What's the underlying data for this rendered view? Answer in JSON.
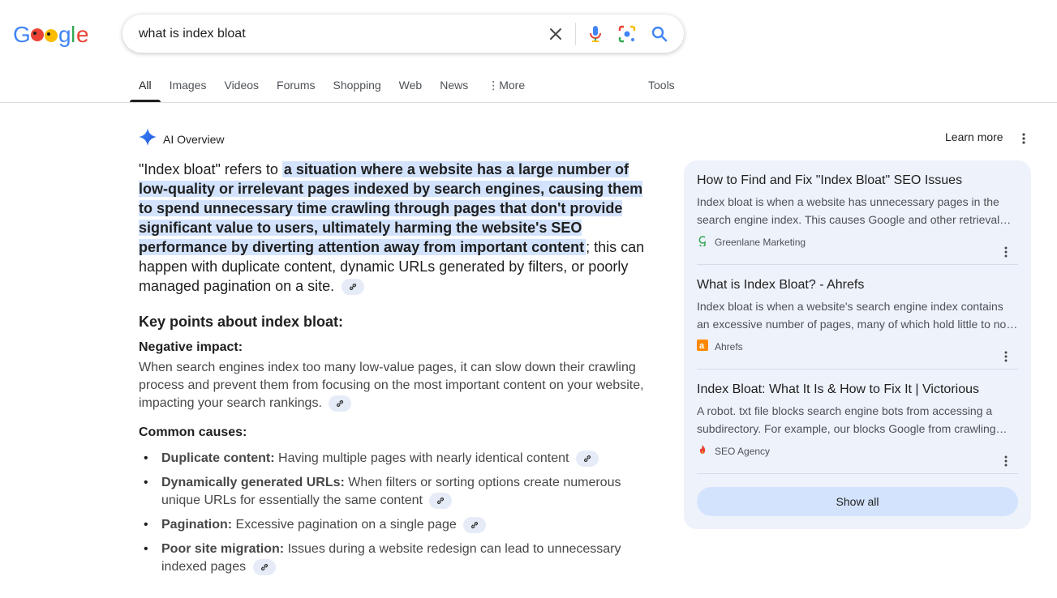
{
  "logo": {
    "text": "Google"
  },
  "search": {
    "query": "what is index bloat"
  },
  "tabs": [
    {
      "label": "All"
    },
    {
      "label": "Images"
    },
    {
      "label": "Videos"
    },
    {
      "label": "Forums"
    },
    {
      "label": "Shopping"
    },
    {
      "label": "Web"
    },
    {
      "label": "News"
    },
    {
      "label": "More"
    }
  ],
  "tools_label": "Tools",
  "ai_overview": {
    "label": "AI Overview",
    "learn_more": "Learn more",
    "intro_pre": "\"Index bloat\" refers to ",
    "intro_highlight": "a situation where a website has a large number of low-quality or irrelevant pages indexed by search engines, causing them to spend unnecessary time crawling through pages that don't provide significant value to users, ultimately harming the website's SEO performance by diverting attention away from important content",
    "intro_post": "; this can happen with duplicate content, dynamic URLs generated by filters, or poorly managed pagination on a site.",
    "key_points_heading": "Key points about index bloat:",
    "negative_heading": "Negative impact:",
    "negative_text": "When search engines index too many low-value pages, it can slow down their crawling process and prevent them from focusing on the most important content on your website, impacting your search rankings.",
    "causes_heading": "Common causes:",
    "causes": [
      {
        "term": "Duplicate content:",
        "text": " Having multiple pages with nearly identical content"
      },
      {
        "term": "Dynamically generated URLs:",
        "text": " When filters or sorting options create numerous unique URLs for essentially the same content"
      },
      {
        "term": "Pagination:",
        "text": " Excessive pagination on a single page"
      },
      {
        "term": "Poor site migration:",
        "text": " Issues during a website redesign can lead to unnecessary indexed pages"
      }
    ]
  },
  "sources": [
    {
      "title": "How to Find and Fix \"Index Bloat\" SEO Issues",
      "snippet": "Index bloat is when a website has unnecessary pages in the search engine index. This causes Google and other retrieval…",
      "site": "Greenlane Marketing"
    },
    {
      "title": "What is Index Bloat? - Ahrefs",
      "snippet": "Index bloat is when a website's search engine index contains an excessive number of pages, many of which hold little to no…",
      "site": "Ahrefs"
    },
    {
      "title": "Index Bloat: What It Is & How to Fix It | Victorious",
      "snippet": "A robot. txt file blocks search engine bots from accessing a subdirectory. For example, our blocks Google from crawling…",
      "site": "SEO Agency"
    }
  ],
  "show_all": "Show all",
  "colors": {
    "highlight": "#d3e3fd",
    "panel": "#eef2fb",
    "blue": "#4285f4",
    "red": "#ea4335",
    "yellow": "#fbbc04",
    "green": "#34a853"
  },
  "icons": [
    "clear-icon",
    "mic-icon",
    "lens-icon",
    "search-icon",
    "sparkle-icon",
    "kebab-icon",
    "link-icon"
  ]
}
